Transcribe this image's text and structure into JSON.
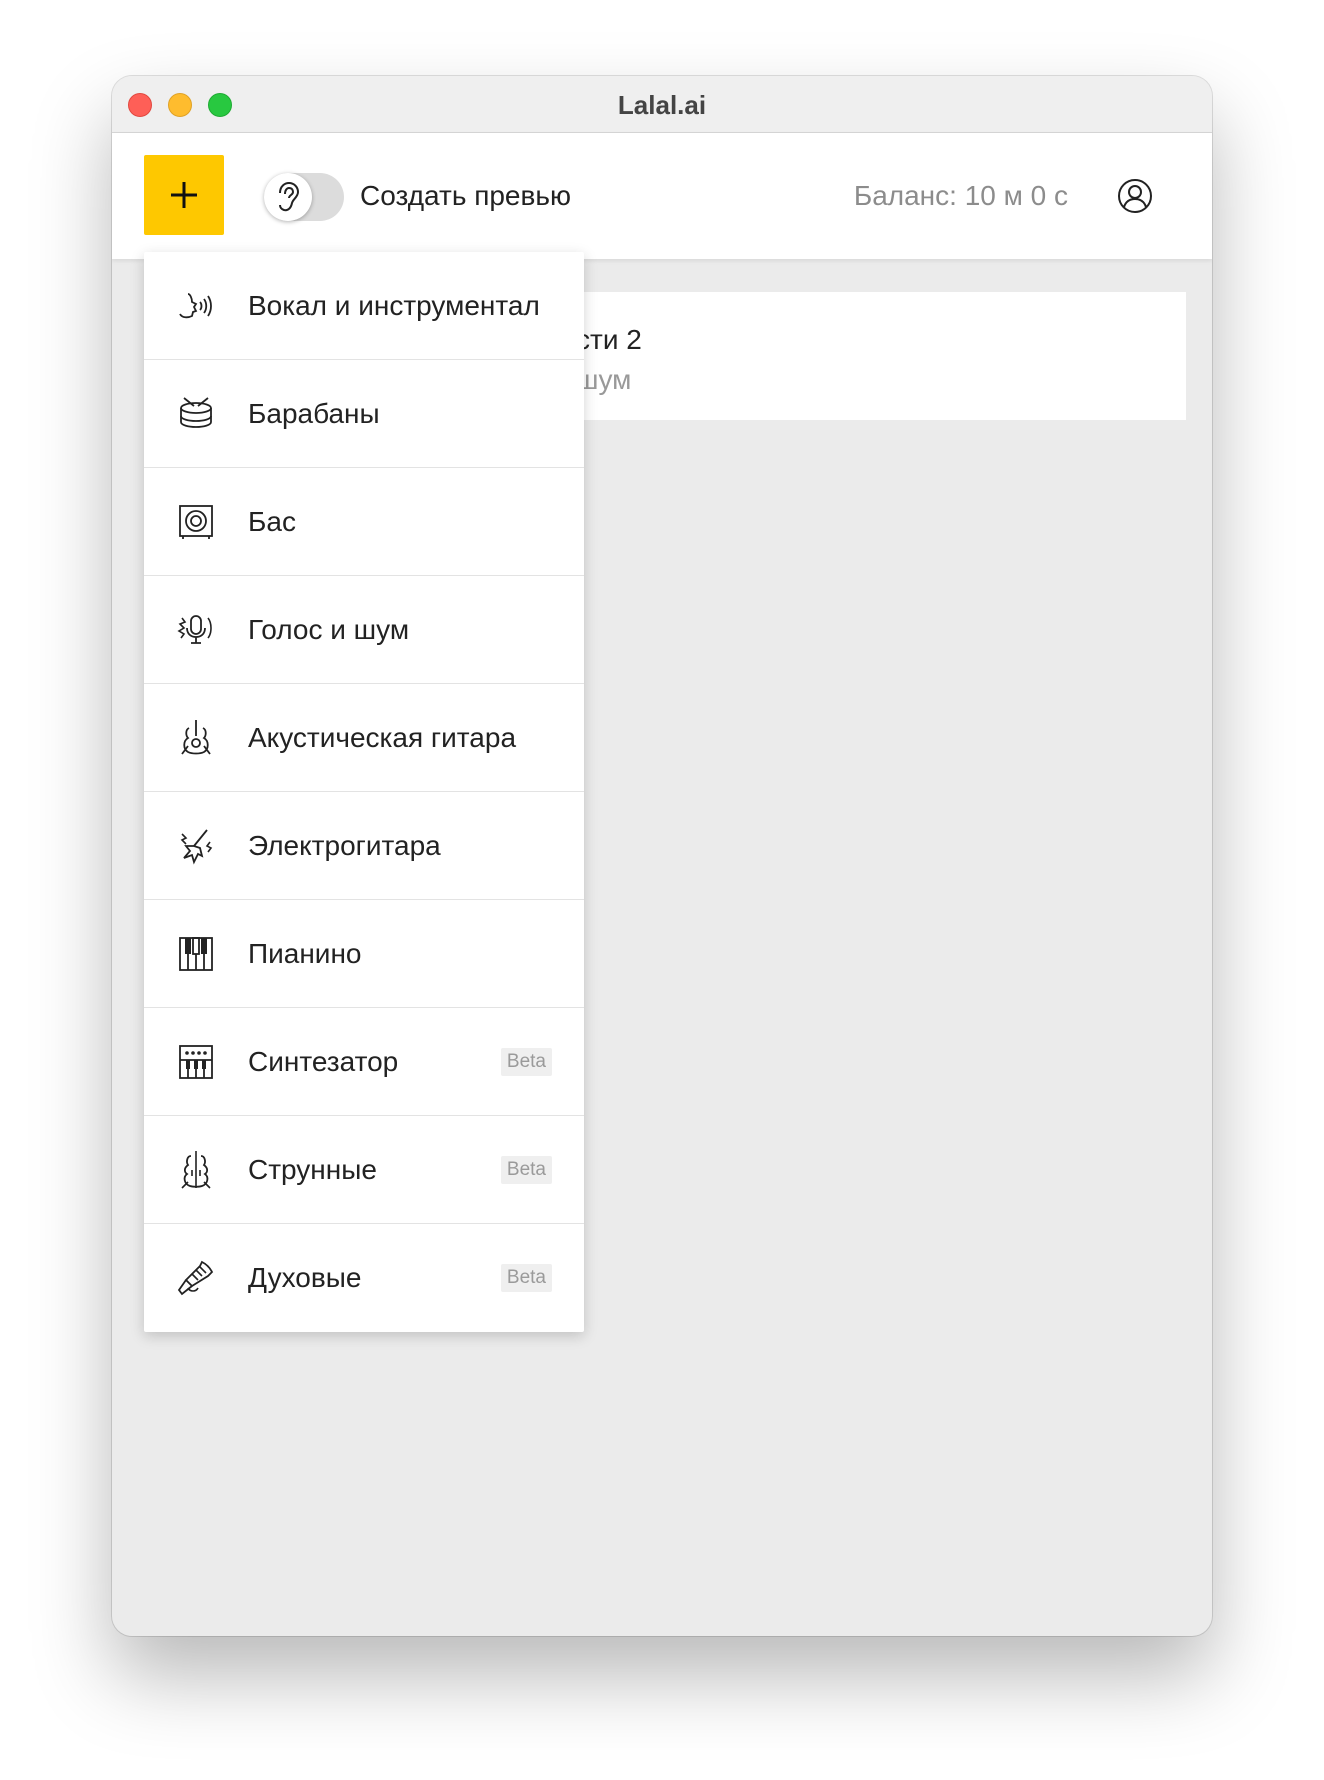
{
  "window": {
    "title": "Lalal.ai"
  },
  "toolbar": {
    "add_label": "+",
    "preview_label": "Создать превью",
    "balance": "Баланс: 10 м 0 с",
    "preview_enabled": false
  },
  "card": {
    "title_fragment": "сти 2",
    "subtitle_fragment": "шум"
  },
  "menu": {
    "items": [
      {
        "label": "Вокал и инструментал",
        "icon": "vocal-icon",
        "beta": ""
      },
      {
        "label": "Барабаны",
        "icon": "drum-icon",
        "beta": ""
      },
      {
        "label": "Бас",
        "icon": "bass-speaker-icon",
        "beta": ""
      },
      {
        "label": "Голос и шум",
        "icon": "microphone-noise-icon",
        "beta": ""
      },
      {
        "label": "Акустическая гитара",
        "icon": "acoustic-guitar-icon",
        "beta": ""
      },
      {
        "label": "Электрогитара",
        "icon": "electric-guitar-icon",
        "beta": ""
      },
      {
        "label": "Пианино",
        "icon": "piano-icon",
        "beta": ""
      },
      {
        "label": "Синтезатор",
        "icon": "synthesizer-icon",
        "beta": "Beta"
      },
      {
        "label": "Струнные",
        "icon": "violin-icon",
        "beta": "Beta"
      },
      {
        "label": "Духовые",
        "icon": "trumpet-icon",
        "beta": "Beta"
      }
    ]
  }
}
